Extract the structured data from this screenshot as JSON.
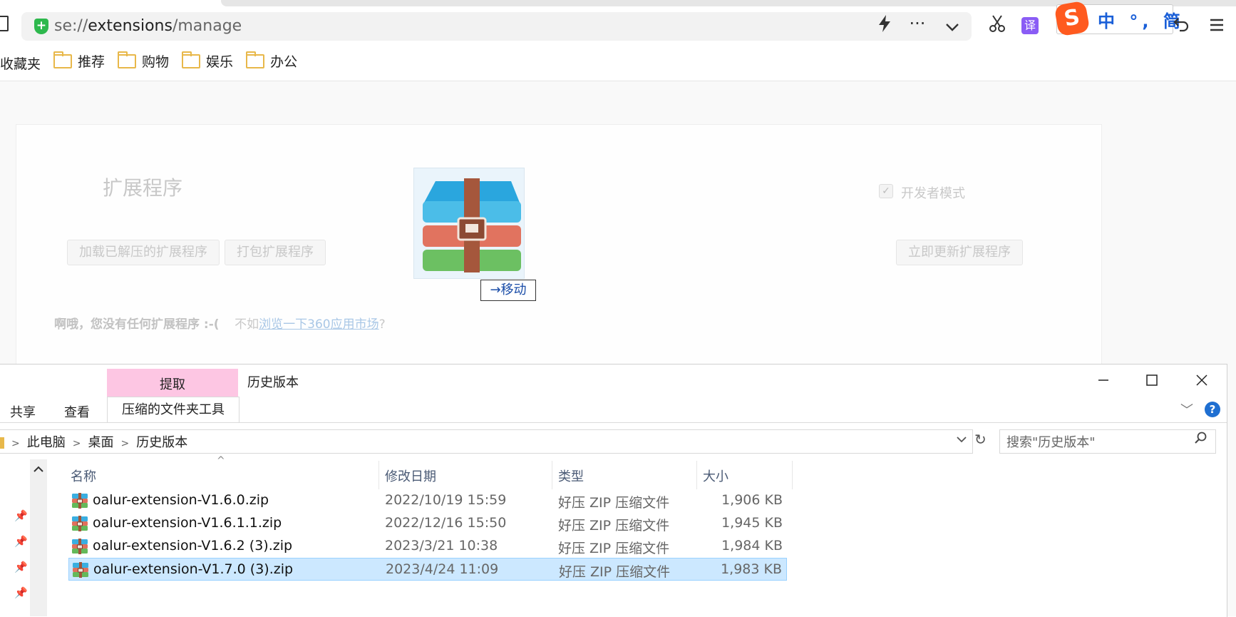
{
  "browser": {
    "url_scheme": "se://",
    "url_host": "extensions",
    "url_path": "/manage",
    "bookmarks": [
      {
        "label": "收藏夹",
        "folder": false
      },
      {
        "label": "推荐",
        "folder": true
      },
      {
        "label": "购物",
        "folder": true
      },
      {
        "label": "娱乐",
        "folder": true
      },
      {
        "label": "办公",
        "folder": true
      }
    ],
    "translate_label": "译",
    "ime": {
      "logo": "S",
      "text": "中 °, 简"
    }
  },
  "extensions_page": {
    "title": "扩展程序",
    "load_unpacked_button": "加载已解压的扩展程序",
    "pack_button": "打包扩展程序",
    "developer_mode_label": "开发者模式",
    "developer_mode_checked": true,
    "update_button": "立即更新扩展程序",
    "empty_bold": "啊哦，您没有任何扩展程序 :-(",
    "empty_prefix": "不如",
    "empty_link": "浏览一下360应用市场",
    "empty_suffix": "?"
  },
  "drag_tooltip": {
    "arrow": "→",
    "label": "移动"
  },
  "explorer": {
    "context_tab": "提取",
    "title": "历史版本",
    "ribbon_tabs": [
      "共享",
      "查看"
    ],
    "context_tools_tab": "压缩的文件夹工具",
    "breadcrumb": [
      "此电脑",
      "桌面",
      "历史版本"
    ],
    "search_placeholder": "搜索\"历史版本\"",
    "columns": {
      "name": "名称",
      "date": "修改日期",
      "type": "类型",
      "size": "大小"
    },
    "files": [
      {
        "name": "oalur-extension-V1.6.0.zip",
        "date": "2022/10/19 15:59",
        "type": "好压 ZIP 压缩文件",
        "size": "1,906 KB",
        "selected": false
      },
      {
        "name": "oalur-extension-V1.6.1.1.zip",
        "date": "2022/12/16 15:50",
        "type": "好压 ZIP 压缩文件",
        "size": "1,945 KB",
        "selected": false
      },
      {
        "name": "oalur-extension-V1.6.2 (3).zip",
        "date": "2023/3/21 10:38",
        "type": "好压 ZIP 压缩文件",
        "size": "1,984 KB",
        "selected": false
      },
      {
        "name": "oalur-extension-V1.7.0 (3).zip",
        "date": "2023/4/24 11:09",
        "type": "好压 ZIP 压缩文件",
        "size": "1,983 KB",
        "selected": true
      }
    ]
  },
  "colors": {
    "accent": "#1f6fd1",
    "selection": "#cce8ff",
    "context_tab": "#fdc6e3",
    "shield": "#2db84d"
  }
}
